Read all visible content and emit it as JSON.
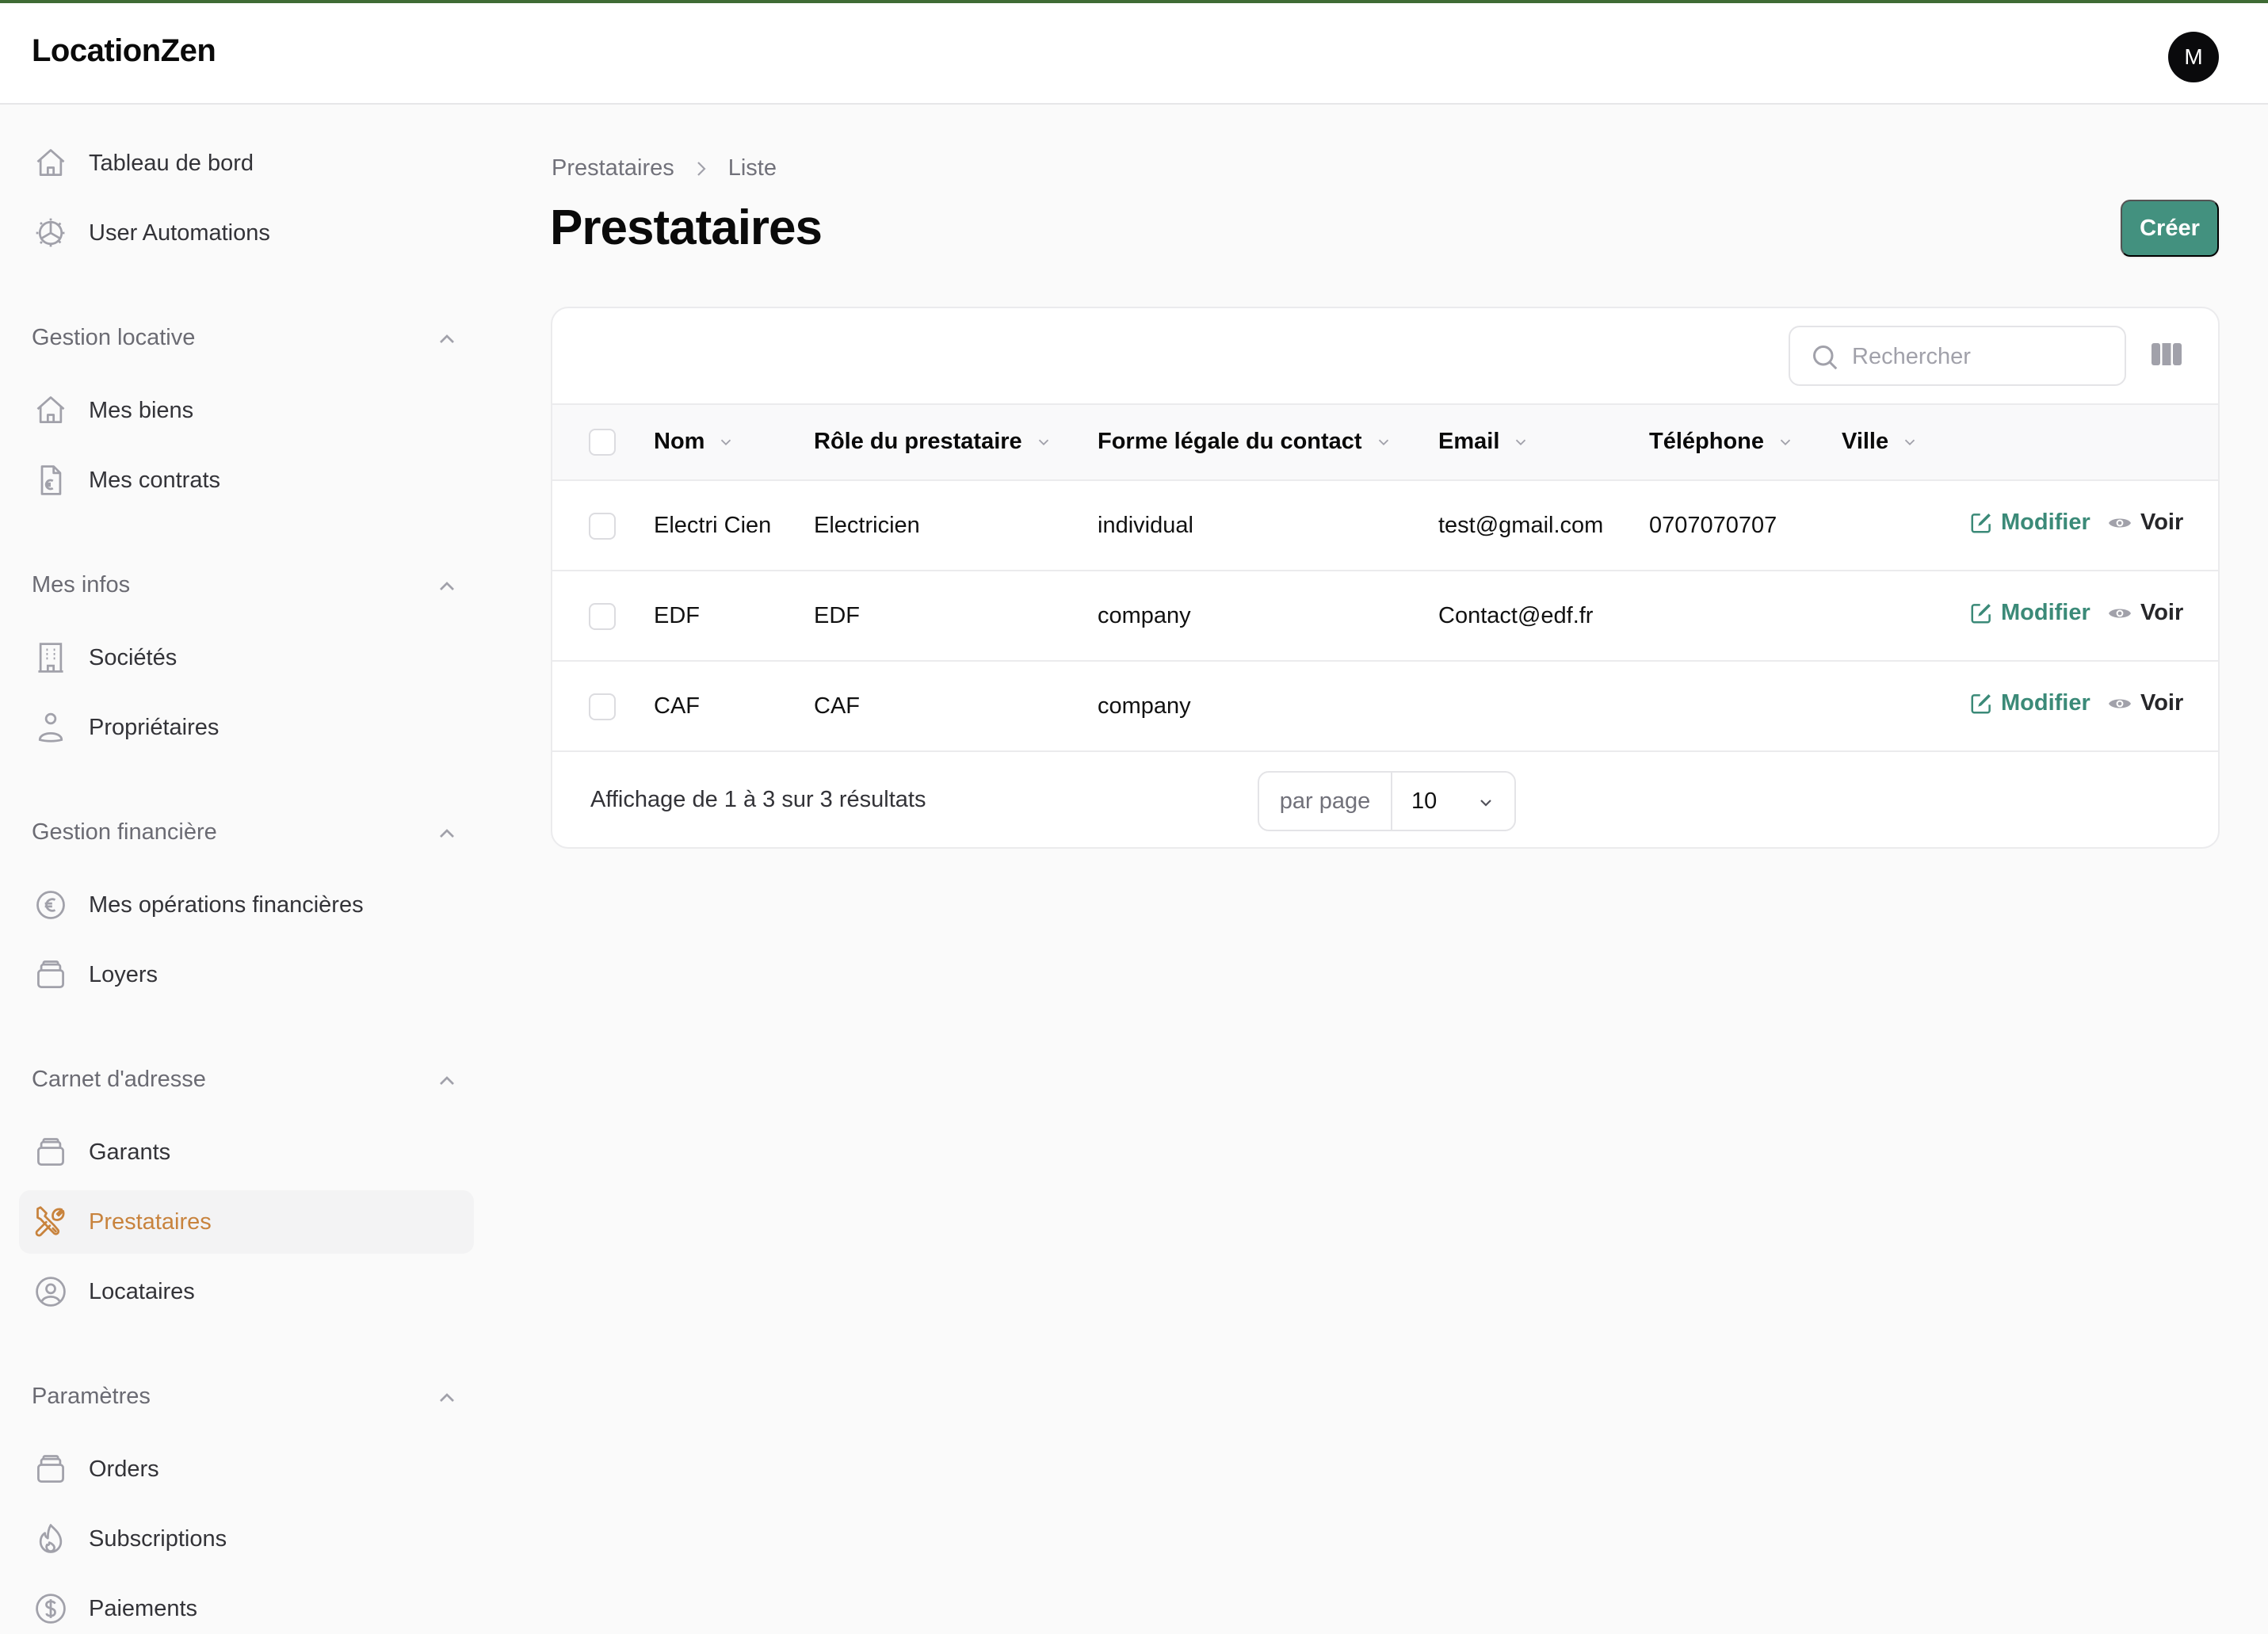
{
  "app": {
    "brand": "LocationZen",
    "avatar_initial": "M",
    "accent_color": "#43917f",
    "active_nav_color": "#c8833d"
  },
  "sidebar": {
    "top_items": [
      {
        "label": "Tableau de bord",
        "icon": "home-icon"
      },
      {
        "label": "User Automations",
        "icon": "gear-icon"
      }
    ],
    "groups": [
      {
        "title": "Gestion locative",
        "items": [
          {
            "label": "Mes biens",
            "icon": "home-icon"
          },
          {
            "label": "Mes contrats",
            "icon": "document-euro-icon"
          }
        ]
      },
      {
        "title": "Mes infos",
        "items": [
          {
            "label": "Sociétés",
            "icon": "building-icon"
          },
          {
            "label": "Propriétaires",
            "icon": "user-icon"
          }
        ]
      },
      {
        "title": "Gestion financière",
        "items": [
          {
            "label": "Mes opérations financières",
            "icon": "euro-circle-icon"
          },
          {
            "label": "Loyers",
            "icon": "stack-icon"
          }
        ]
      },
      {
        "title": "Carnet d'adresse",
        "items": [
          {
            "label": "Garants",
            "icon": "stack-icon"
          },
          {
            "label": "Prestataires",
            "icon": "tools-icon",
            "active": true
          },
          {
            "label": "Locataires",
            "icon": "user-circle-icon"
          }
        ]
      },
      {
        "title": "Paramètres",
        "items": [
          {
            "label": "Orders",
            "icon": "stack-icon"
          },
          {
            "label": "Subscriptions",
            "icon": "fire-icon"
          },
          {
            "label": "Paiements",
            "icon": "dollar-circle-icon"
          }
        ]
      }
    ]
  },
  "breadcrumb": [
    "Prestataires",
    "Liste"
  ],
  "page": {
    "title": "Prestataires",
    "create_label": "Créer"
  },
  "table": {
    "search_placeholder": "Rechercher",
    "search_value": "",
    "columns": [
      "Nom",
      "Rôle du prestataire",
      "Forme légale du contact",
      "Email",
      "Téléphone",
      "Ville"
    ],
    "rows": [
      {
        "nom": "Electri Cien",
        "role": "Electricien",
        "forme": "individual",
        "email": "test@gmail.com",
        "telephone": "0707070707",
        "ville": ""
      },
      {
        "nom": "EDF",
        "role": "EDF",
        "forme": "company",
        "email": "Contact@edf.fr",
        "telephone": "",
        "ville": ""
      },
      {
        "nom": "CAF",
        "role": "CAF",
        "forme": "company",
        "email": "",
        "telephone": "",
        "ville": ""
      }
    ],
    "actions": {
      "edit": "Modifier",
      "view": "Voir"
    },
    "footer": {
      "summary": "Affichage de 1 à 3 sur 3 résultats",
      "per_page_label": "par page",
      "per_page_value": "10"
    }
  }
}
